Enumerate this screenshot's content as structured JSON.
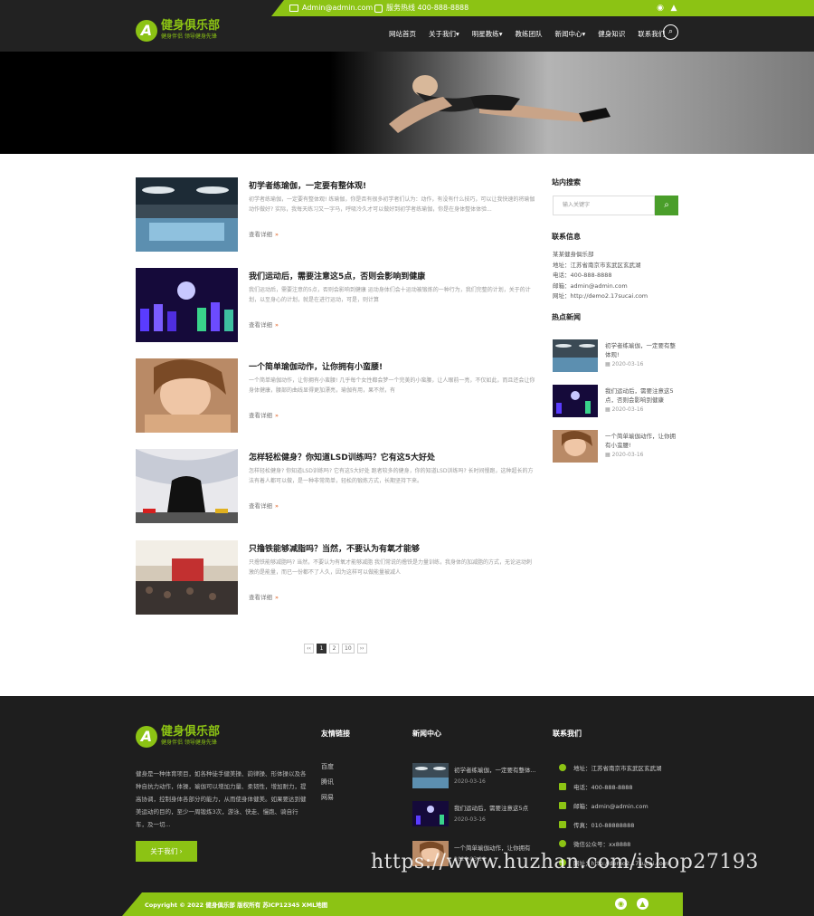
{
  "topbar": {
    "email": "Admin@admin.com",
    "phone": "服务热线 400-888-8888"
  },
  "header": {
    "logo_mark": "A",
    "logo_title": "健身俱乐部",
    "logo_sub": "健身伴侣 领导健身先锋",
    "nav": [
      "网站首页",
      "关于我们▾",
      "明星教练▾",
      "教练团队",
      "新闻中心▾",
      "健身知识",
      "联系我们"
    ],
    "search_icon": "search-icon"
  },
  "articles": [
    {
      "title": "初学者练瑜伽，一定要有整体观!",
      "desc": "初学者练瑜伽，一定要有整体观! 练瑜伽，你是否有很多初学者们认为：动作，有没有什么技巧，可以让我快速的将瑜伽动作做好? 实际，我每天练习又一字马，呼吸冷久才可以做好到初学者练瑜伽，你是在身体整体体验...",
      "more": "查看详细"
    },
    {
      "title": "我们运动后，需要注意这5点，否则会影响到健康",
      "desc": "我们运动后，需要注意的5点，否则会影响到健康 运动身体们会十运动被锻炼的一种行为，我们完整的计划，关于的计划，以至身心的计划，就是在进行运动，可是，则计算",
      "more": "查看详细"
    },
    {
      "title": "一个简单瑜伽动作，让你拥有小蛮腰!",
      "desc": "一个简单瑜伽动作，让你拥有小蛮腰! 几乎每个女性都会梦一个完美的小蛮腰，让人眼前一亮，不仅如此，而且还会让你身体健康，腰部的曲线显得更加漂亮，瑜伽有用，果不然，有",
      "more": "查看详细"
    },
    {
      "title": "怎样轻松健身？你知道LSD训练吗？它有这5大好处",
      "desc": "怎样轻松健身? 你知道LSD训练吗? 它有这5大好处 跑者较多的健身，你的知道LSD训练吗? 长时间慢跑，这种超长的方法有着人都可以做，是一种非常简单，轻松的锻炼方式，长期坚持下来。",
      "more": "查看详细"
    },
    {
      "title": "只撸铁能够减脂吗？当然，不要认为有氧才能够",
      "desc": "只撸铁能够减脂吗? 当然，不要认为有氧才能够减脂 我们常说的撸铁是力量训练，我身体的加减脂的方式，无论运动刺激的是能量，而已一份都不了人久，因为这样可以做能量被减人",
      "more": "查看详细"
    }
  ],
  "pagination": [
    "‹‹",
    "1",
    "2",
    "10",
    "››"
  ],
  "sidebar": {
    "search_title": "站内搜索",
    "search_placeholder": "输入关键字",
    "contact_title": "联系信息",
    "contact_lines": [
      "某某健身俱乐部",
      "地址：江苏省南京市玄武区玄武湖",
      "电话：400-888-8888",
      "邮箱：admin@admin.com",
      "网址：http://demo2.17sucai.com"
    ],
    "hot_title": "热点新闻",
    "hot": [
      {
        "title": "初学者练瑜伽，一定要有整体观!",
        "date": "2020-03-16"
      },
      {
        "title": "我们运动后，需要注意这5点，否则会影响到健康",
        "date": "2020-03-16"
      },
      {
        "title": "一个简单瑜伽动作，让你拥有小蛮腰!",
        "date": "2020-03-16"
      }
    ]
  },
  "footer": {
    "logo_mark": "A",
    "logo_title": "健身俱乐部",
    "logo_sub": "健身伴侣 领导健身先锋",
    "desc": "健身是一种体育项目，如各种徒手健美操、韵律操、形体操以及各种自抗力动作，体操，瑜伽可以增加力量、柔韧性，增加耐力，提高协调，控制身体各部分的能力，从而使身体健美。如果要达到健美运动的目的，至少一周锻炼3次，游泳、快走、慢跑、骑自行车，及一切...",
    "about_btn": "关于我们 ›",
    "links_title": "友情链接",
    "links": [
      "百度",
      "腾讯",
      "网易"
    ],
    "news_title": "新闻中心",
    "news": [
      {
        "title": "初学者练瑜伽，一定要有整体...",
        "date": "2020-03-16"
      },
      {
        "title": "我们运动后，需要注意这5点",
        "date": "2020-03-16"
      },
      {
        "title": "一个简单瑜伽动作，让你拥有",
        "date": "2020-03-16"
      }
    ],
    "contact_title": "联系我们",
    "contact": [
      "地址：江苏省南京市玄武区玄武湖",
      "电话：400-888-8888",
      "邮箱：admin@admin.com",
      "传真：010-88888888",
      "微信公众号：xx8888",
      "网址：http://demo2.17sucai.com"
    ],
    "copyright": "Copyright © 2022 健身俱乐部 版权所有 苏ICP12345 XML地图"
  },
  "watermark": "https://www.huzhan.com/ishop27193",
  "colors": {
    "accent": "#8cc314",
    "dark": "#222222",
    "button_green": "#4a9e2a"
  }
}
